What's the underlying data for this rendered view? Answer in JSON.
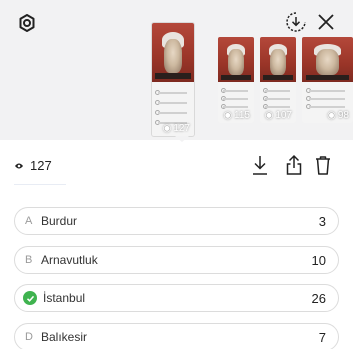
{
  "header": {
    "settings_icon": "gear-icon",
    "download_icon": "circle-download-icon",
    "close_icon": "close-icon"
  },
  "stories": [
    {
      "views": "127"
    },
    {
      "views": "115"
    },
    {
      "views": "107"
    },
    {
      "views": "98"
    }
  ],
  "viewers": {
    "count": "127",
    "icon": "eye-icon"
  },
  "actions": {
    "download_icon": "download-icon",
    "share_icon": "share-icon",
    "delete_icon": "trash-icon"
  },
  "quiz": {
    "correct_color": "#3fb34f",
    "options": [
      {
        "letter": "A",
        "label": "Burdur",
        "votes": "3",
        "correct": false
      },
      {
        "letter": "B",
        "label": "Arnavutluk",
        "votes": "10",
        "correct": false
      },
      {
        "letter": "C",
        "label": "İstanbul",
        "votes": "26",
        "correct": true
      },
      {
        "letter": "D",
        "label": "Balıkesir",
        "votes": "7",
        "correct": false
      }
    ]
  }
}
